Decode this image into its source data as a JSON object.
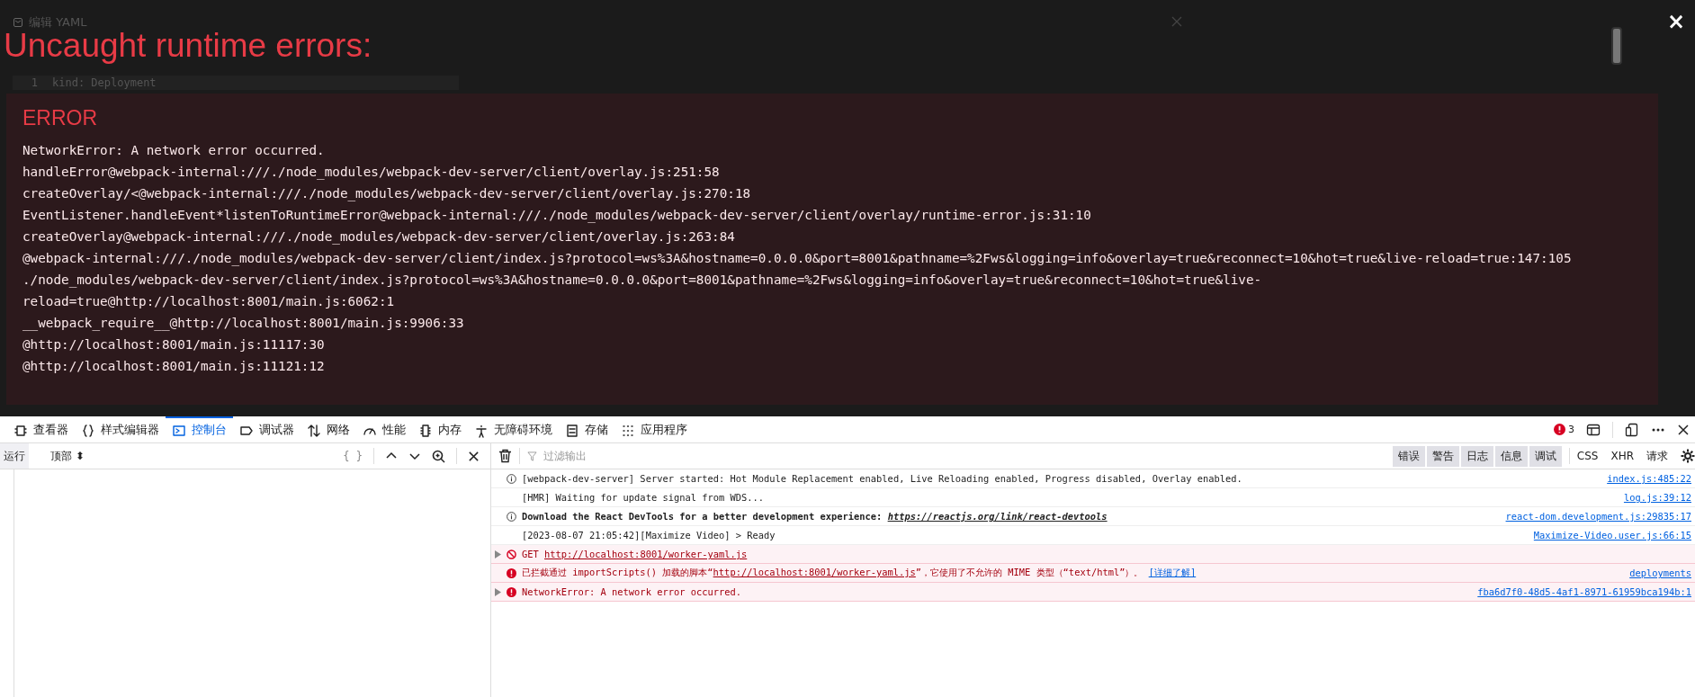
{
  "background_page": {
    "dialog_title": "编辑 YAML",
    "code_lines": [
      {
        "number": "1",
        "text": "kind: Deployment"
      }
    ]
  },
  "overlay": {
    "title": "Uncaught runtime errors:",
    "close": "×",
    "error": {
      "label": "ERROR",
      "lines": [
        "NetworkError: A network error occurred.",
        "handleError@webpack-internal:///./node_modules/webpack-dev-server/client/overlay.js:251:58",
        "createOverlay/<@webpack-internal:///./node_modules/webpack-dev-server/client/overlay.js:270:18",
        "EventListener.handleEvent*listenToRuntimeError@webpack-internal:///./node_modules/webpack-dev-server/client/overlay/runtime-error.js:31:10",
        "createOverlay@webpack-internal:///./node_modules/webpack-dev-server/client/overlay.js:263:84",
        "@webpack-internal:///./node_modules/webpack-dev-server/client/index.js?protocol=ws%3A&hostname=0.0.0.0&port=8001&pathname=%2Fws&logging=info&overlay=true&reconnect=10&hot=true&live-reload=true:147:105",
        "./node_modules/webpack-dev-server/client/index.js?protocol=ws%3A&hostname=0.0.0.0&port=8001&pathname=%2Fws&logging=info&overlay=true&reconnect=10&hot=true&live-reload=true@http://localhost:8001/main.js:6062:1",
        "__webpack_require__@http://localhost:8001/main.js:9906:33",
        "@http://localhost:8001/main.js:11117:30",
        "@http://localhost:8001/main.js:11121:12"
      ]
    }
  },
  "devtools": {
    "tabs": [
      {
        "label": "查看器",
        "selected": false
      },
      {
        "label": "样式编辑器",
        "selected": false
      },
      {
        "label": "控制台",
        "selected": true
      },
      {
        "label": "调试器",
        "selected": false
      },
      {
        "label": "网络",
        "selected": false
      },
      {
        "label": "性能",
        "selected": false
      },
      {
        "label": "内存",
        "selected": false
      },
      {
        "label": "无障碍环境",
        "selected": false
      },
      {
        "label": "存储",
        "selected": false
      },
      {
        "label": "应用程序",
        "selected": false
      }
    ],
    "error_count": "3",
    "debugger_pane": {
      "run_button": "运行",
      "context": "顶部 ⬍",
      "pretty_print": "{ }"
    },
    "console": {
      "filter_placeholder": "过滤输出",
      "levels": [
        {
          "label": "错误",
          "selected": true
        },
        {
          "label": "警告",
          "selected": true
        },
        {
          "label": "日志",
          "selected": true
        },
        {
          "label": "信息",
          "selected": true
        },
        {
          "label": "调试",
          "selected": true
        }
      ],
      "categories": [
        {
          "label": "CSS",
          "selected": false
        },
        {
          "label": "XHR",
          "selected": false
        },
        {
          "label": "请求",
          "selected": false
        }
      ],
      "messages": [
        {
          "kind": "info",
          "expandable": false,
          "bold": false,
          "parts": [
            {
              "text": "[webpack-dev-server] Server started: Hot Module Replacement enabled, Live Reloading enabled, Progress disabled, Overlay enabled."
            }
          ],
          "source": "index.js:485:22"
        },
        {
          "kind": "log",
          "expandable": false,
          "bold": false,
          "parts": [
            {
              "text": "[HMR] Waiting for update signal from WDS..."
            }
          ],
          "source": "log.js:39:12"
        },
        {
          "kind": "info",
          "expandable": false,
          "bold": true,
          "parts": [
            {
              "text": "Download the React DevTools for a better development experience: "
            },
            {
              "link": "https://reactjs.org/link/react-devtools"
            }
          ],
          "source": "react-dom.development.js:29835:17"
        },
        {
          "kind": "log",
          "expandable": false,
          "bold": false,
          "parts": [
            {
              "text": "[2023-08-07 21:05:42][Maximize Video] > Ready"
            }
          ],
          "source": "Maximize-Video.user.js:66:15"
        },
        {
          "kind": "blocked",
          "expandable": true,
          "bold": false,
          "parts": [
            {
              "text": "GET "
            },
            {
              "link": "http://localhost:8001/worker-yaml.js"
            }
          ]
        },
        {
          "kind": "error",
          "expandable": false,
          "bold": false,
          "parts": [
            {
              "text": "已拦截通过 importScripts() 加载的脚本“"
            },
            {
              "link": "http://localhost:8001/worker-yaml.js"
            },
            {
              "text": "”，它使用了不允许的 MIME 类型（“text/html”）。 "
            },
            {
              "help": "[详细了解]"
            }
          ],
          "source": "deployments"
        },
        {
          "kind": "error",
          "expandable": true,
          "bold": false,
          "parts": [
            {
              "text": "NetworkError: A network error occurred."
            }
          ],
          "source": "fba6d7f0-48d5-4af1-8971-61959bca194b:1"
        }
      ]
    }
  }
}
